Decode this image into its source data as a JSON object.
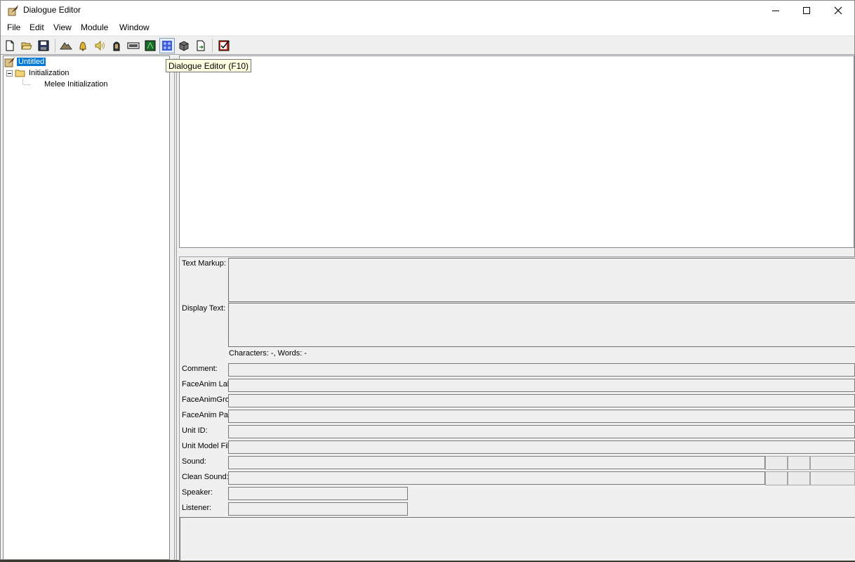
{
  "window": {
    "title": "Dialogue Editor",
    "icon": "quill-parchment-icon",
    "controls": [
      "minimize-icon",
      "maximize-icon",
      "close-icon"
    ]
  },
  "menu": [
    "File",
    "Edit",
    "View",
    "Module",
    "Window"
  ],
  "toolbar": {
    "buttons": [
      "new-file-icon",
      "open-folder-icon",
      "save-icon",
      "terrain-icon",
      "bell-icon",
      "sound-icon",
      "pharaoh-icon",
      "film-icon",
      "green-screen-icon",
      "dialogue-editor-icon",
      "cube-icon",
      "export-file-icon",
      "checklist-icon"
    ],
    "tooltip": "Dialogue Editor (F10)"
  },
  "tree": {
    "root": "Untitled",
    "folder": "Initialization",
    "child": "Melee Initialization"
  },
  "properties": {
    "text_markup_label": "Text Markup:",
    "display_text_label": "Display Text:",
    "counts": "Characters: -, Words: -",
    "comment_label": "Comment:",
    "faceanim_label_label": "FaceAnim Label:",
    "faceanim_group_label": "FaceAnimGroup:",
    "faceanim_path_label": "FaceAnim Path:",
    "unit_id_label": "Unit ID:",
    "unit_model_label": "Unit Model File:",
    "sound_label": "Sound:",
    "clean_sound_label": "Clean Sound:",
    "speaker_label": "Speaker:",
    "listener_label": "Listener:"
  }
}
